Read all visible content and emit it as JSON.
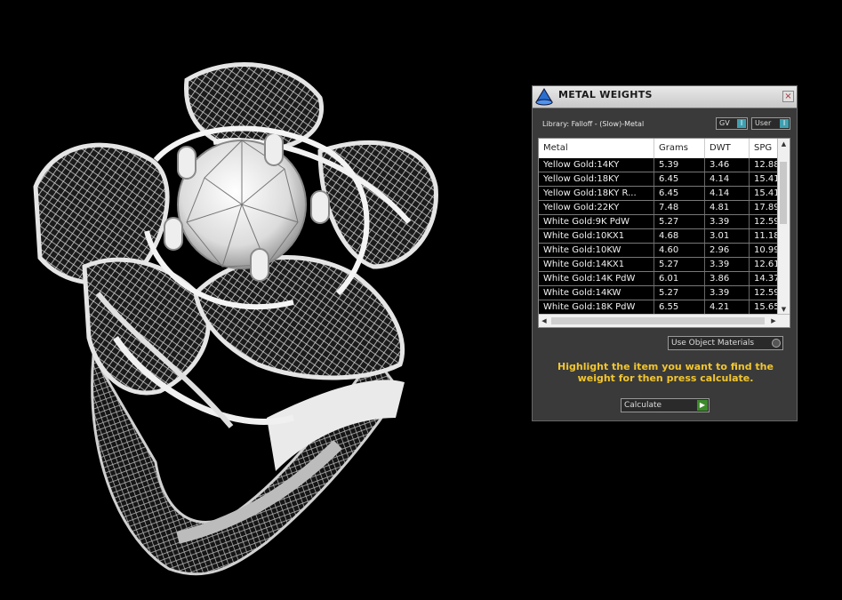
{
  "panel": {
    "title": "METAL WEIGHTS",
    "close_glyph": "×",
    "library_label": "Library: Falloff - (Slow)-Metal",
    "toggle_gv": "GV",
    "toggle_user": "User",
    "toggle_knob": "I",
    "use_object_materials": "Use Object Materials",
    "instruction": "Highlight the item you want to find the weight for then press calculate.",
    "calculate": "Calculate",
    "calculate_icon": "play-arrow-icon",
    "accent_color": "#f2c62f"
  },
  "table": {
    "columns": [
      "Metal",
      "Grams",
      "DWT",
      "SPG"
    ],
    "rows": [
      [
        "Yellow Gold:14KY",
        "5.39",
        "3.46",
        "12.88"
      ],
      [
        "Yellow Gold:18KY",
        "6.45",
        "4.14",
        "15.41"
      ],
      [
        "Yellow Gold:18KY R...",
        "6.45",
        "4.14",
        "15.41"
      ],
      [
        "Yellow Gold:22KY",
        "7.48",
        "4.81",
        "17.89"
      ],
      [
        "White Gold:9K PdW",
        "5.27",
        "3.39",
        "12.59"
      ],
      [
        "White Gold:10KX1",
        "4.68",
        "3.01",
        "11.18"
      ],
      [
        "White Gold:10KW",
        "4.60",
        "2.96",
        "10.99"
      ],
      [
        "White Gold:14KX1",
        "5.27",
        "3.39",
        "12.61"
      ],
      [
        "White Gold:14K PdW",
        "6.01",
        "3.86",
        "14.37"
      ],
      [
        "White Gold:14KW",
        "5.27",
        "3.39",
        "12.59"
      ],
      [
        "White Gold:18K PdW",
        "6.55",
        "4.21",
        "15.65"
      ]
    ]
  }
}
